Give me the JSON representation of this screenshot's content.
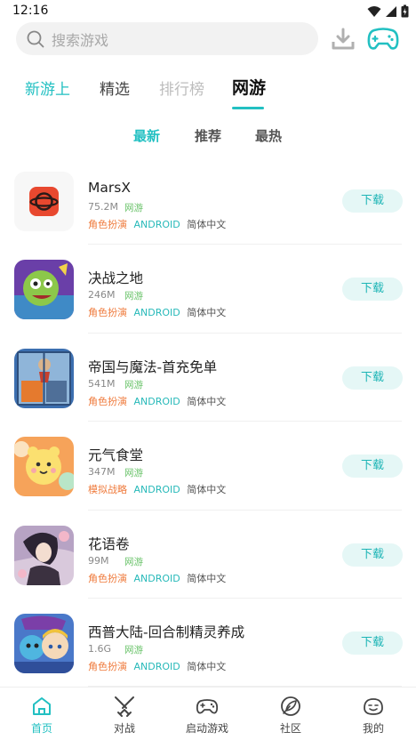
{
  "status": {
    "time": "12:16"
  },
  "search": {
    "placeholder": "搜索游戏"
  },
  "tabs": [
    {
      "label": "新游上"
    },
    {
      "label": "精选"
    },
    {
      "label": "排行榜"
    },
    {
      "label": "网游"
    }
  ],
  "subtabs": [
    {
      "label": "最新"
    },
    {
      "label": "推荐"
    },
    {
      "label": "最热"
    }
  ],
  "games": [
    {
      "name": "MarsX",
      "size": "75.2M",
      "kind": "网游",
      "genre": "角色扮演",
      "platform": "ANDROID",
      "lang": "简体中文",
      "button": "下载"
    },
    {
      "name": "决战之地",
      "size": "246M",
      "kind": "网游",
      "genre": "角色扮演",
      "platform": "ANDROID",
      "lang": "简体中文",
      "button": "下载"
    },
    {
      "name": "帝国与魔法-首充免单",
      "size": "541M",
      "kind": "网游",
      "genre": "角色扮演",
      "platform": "ANDROID",
      "lang": "简体中文",
      "button": "下载"
    },
    {
      "name": "元气食堂",
      "size": "347M",
      "kind": "网游",
      "genre": "模拟战略",
      "platform": "ANDROID",
      "lang": "简体中文",
      "button": "下载"
    },
    {
      "name": "花语卷",
      "size": "99M",
      "kind": "网游",
      "genre": "角色扮演",
      "platform": "ANDROID",
      "lang": "简体中文",
      "button": "下载"
    },
    {
      "name": "西普大陆-回合制精灵养成",
      "size": "1.6G",
      "kind": "网游",
      "genre": "角色扮演",
      "platform": "ANDROID",
      "lang": "简体中文",
      "button": "下载"
    }
  ],
  "nav": [
    {
      "label": "首页",
      "icon": "home-icon"
    },
    {
      "label": "对战",
      "icon": "swords-icon"
    },
    {
      "label": "启动游戏",
      "icon": "gamepad-icon"
    },
    {
      "label": "社区",
      "icon": "leaf-icon"
    },
    {
      "label": "我的",
      "icon": "face-icon"
    }
  ],
  "colors": {
    "accent": "#22c0c2",
    "genre": "#ef7b3d",
    "kind": "#6ac36a"
  }
}
